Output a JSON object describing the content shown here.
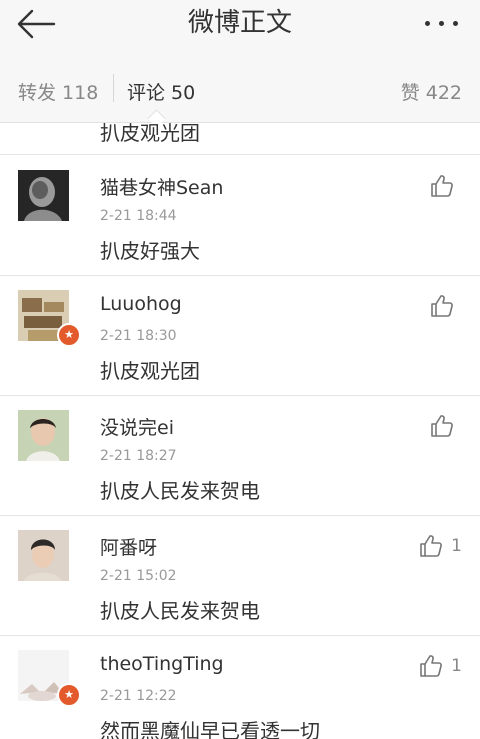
{
  "header": {
    "title": "微博正文",
    "back_icon": "arrow-left-icon",
    "more_icon": "more-dots-icon"
  },
  "tabs": {
    "reposts": "转发 118",
    "comments": "评论 50",
    "likes": "赞 422"
  },
  "prev_comment_text": "扒皮观光团",
  "comments": [
    {
      "name": "猫巷女神Sean",
      "time": "2-21 18:44",
      "text": "扒皮好强大",
      "likes": "",
      "verified": false
    },
    {
      "name": "Luuohog",
      "time": "2-21 18:30",
      "text": "扒皮观光团",
      "likes": "",
      "verified": true
    },
    {
      "name": "没说完ei",
      "time": "2-21 18:27",
      "text": "扒皮人民发来贺电",
      "likes": "",
      "verified": false
    },
    {
      "name": "阿番呀",
      "time": "2-21 15:02",
      "text": "扒皮人民发来贺电",
      "likes": "1",
      "verified": false
    },
    {
      "name": "theoTingTing",
      "time": "2-21 12:22",
      "text": "然而黑魔仙早已看透一切",
      "likes": "1",
      "verified": true
    }
  ],
  "colors": {
    "header_bg": "#f7f7f7",
    "text": "#333333",
    "muted": "#999999",
    "verified_badge": "#e35a2d"
  }
}
